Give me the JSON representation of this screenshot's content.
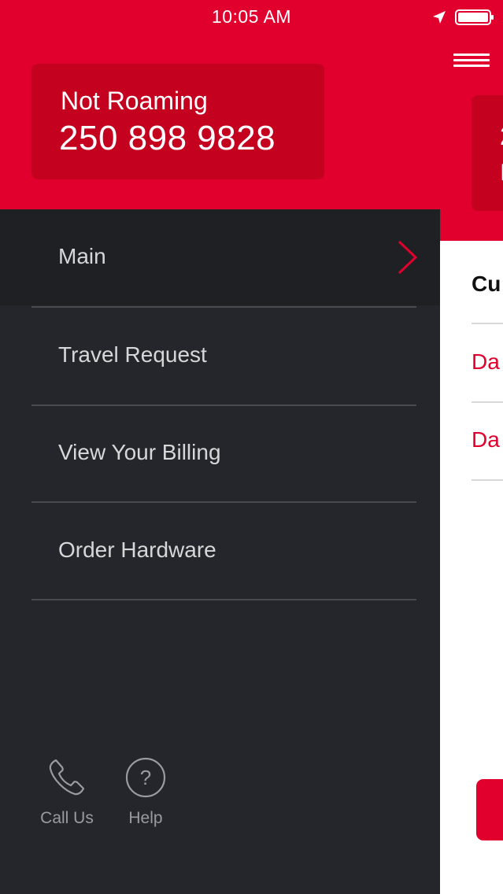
{
  "status_bar": {
    "time": "10:05 AM",
    "location_icon": "location-arrow-icon",
    "battery_icon": "battery-icon"
  },
  "account_card": {
    "status": "Not Roaming",
    "number": "250 898 9828"
  },
  "menu": {
    "items": [
      {
        "label": "Main",
        "active": true
      },
      {
        "label": "Travel Request",
        "active": false
      },
      {
        "label": "View Your Billing",
        "active": false
      },
      {
        "label": "Order Hardware",
        "active": false
      }
    ]
  },
  "footer": {
    "call_label": "Call Us",
    "help_label": "Help",
    "help_glyph": "?"
  },
  "peek": {
    "card_number_fragment": "2",
    "card_bottom_fragment": "I",
    "cu_text": "Cu",
    "row1_text": "Da",
    "row2_text": "Da"
  },
  "colors": {
    "brand_red": "#e1002d",
    "card_red": "#c4021f",
    "panel_dark": "#25262b",
    "text_light": "#d7d7d9"
  }
}
